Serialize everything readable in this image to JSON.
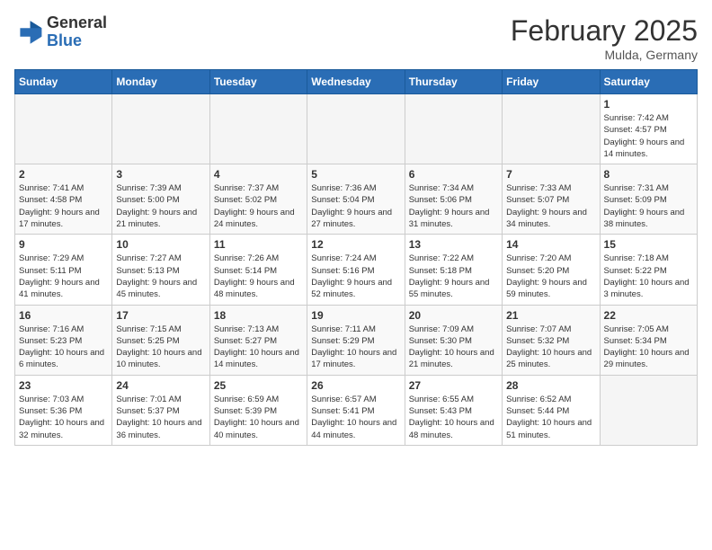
{
  "header": {
    "logo_general": "General",
    "logo_blue": "Blue",
    "month_year": "February 2025",
    "location": "Mulda, Germany"
  },
  "weekdays": [
    "Sunday",
    "Monday",
    "Tuesday",
    "Wednesday",
    "Thursday",
    "Friday",
    "Saturday"
  ],
  "weeks": [
    [
      {
        "day": "",
        "info": ""
      },
      {
        "day": "",
        "info": ""
      },
      {
        "day": "",
        "info": ""
      },
      {
        "day": "",
        "info": ""
      },
      {
        "day": "",
        "info": ""
      },
      {
        "day": "",
        "info": ""
      },
      {
        "day": "1",
        "info": "Sunrise: 7:42 AM\nSunset: 4:57 PM\nDaylight: 9 hours and 14 minutes."
      }
    ],
    [
      {
        "day": "2",
        "info": "Sunrise: 7:41 AM\nSunset: 4:58 PM\nDaylight: 9 hours and 17 minutes."
      },
      {
        "day": "3",
        "info": "Sunrise: 7:39 AM\nSunset: 5:00 PM\nDaylight: 9 hours and 21 minutes."
      },
      {
        "day": "4",
        "info": "Sunrise: 7:37 AM\nSunset: 5:02 PM\nDaylight: 9 hours and 24 minutes."
      },
      {
        "day": "5",
        "info": "Sunrise: 7:36 AM\nSunset: 5:04 PM\nDaylight: 9 hours and 27 minutes."
      },
      {
        "day": "6",
        "info": "Sunrise: 7:34 AM\nSunset: 5:06 PM\nDaylight: 9 hours and 31 minutes."
      },
      {
        "day": "7",
        "info": "Sunrise: 7:33 AM\nSunset: 5:07 PM\nDaylight: 9 hours and 34 minutes."
      },
      {
        "day": "8",
        "info": "Sunrise: 7:31 AM\nSunset: 5:09 PM\nDaylight: 9 hours and 38 minutes."
      }
    ],
    [
      {
        "day": "9",
        "info": "Sunrise: 7:29 AM\nSunset: 5:11 PM\nDaylight: 9 hours and 41 minutes."
      },
      {
        "day": "10",
        "info": "Sunrise: 7:27 AM\nSunset: 5:13 PM\nDaylight: 9 hours and 45 minutes."
      },
      {
        "day": "11",
        "info": "Sunrise: 7:26 AM\nSunset: 5:14 PM\nDaylight: 9 hours and 48 minutes."
      },
      {
        "day": "12",
        "info": "Sunrise: 7:24 AM\nSunset: 5:16 PM\nDaylight: 9 hours and 52 minutes."
      },
      {
        "day": "13",
        "info": "Sunrise: 7:22 AM\nSunset: 5:18 PM\nDaylight: 9 hours and 55 minutes."
      },
      {
        "day": "14",
        "info": "Sunrise: 7:20 AM\nSunset: 5:20 PM\nDaylight: 9 hours and 59 minutes."
      },
      {
        "day": "15",
        "info": "Sunrise: 7:18 AM\nSunset: 5:22 PM\nDaylight: 10 hours and 3 minutes."
      }
    ],
    [
      {
        "day": "16",
        "info": "Sunrise: 7:16 AM\nSunset: 5:23 PM\nDaylight: 10 hours and 6 minutes."
      },
      {
        "day": "17",
        "info": "Sunrise: 7:15 AM\nSunset: 5:25 PM\nDaylight: 10 hours and 10 minutes."
      },
      {
        "day": "18",
        "info": "Sunrise: 7:13 AM\nSunset: 5:27 PM\nDaylight: 10 hours and 14 minutes."
      },
      {
        "day": "19",
        "info": "Sunrise: 7:11 AM\nSunset: 5:29 PM\nDaylight: 10 hours and 17 minutes."
      },
      {
        "day": "20",
        "info": "Sunrise: 7:09 AM\nSunset: 5:30 PM\nDaylight: 10 hours and 21 minutes."
      },
      {
        "day": "21",
        "info": "Sunrise: 7:07 AM\nSunset: 5:32 PM\nDaylight: 10 hours and 25 minutes."
      },
      {
        "day": "22",
        "info": "Sunrise: 7:05 AM\nSunset: 5:34 PM\nDaylight: 10 hours and 29 minutes."
      }
    ],
    [
      {
        "day": "23",
        "info": "Sunrise: 7:03 AM\nSunset: 5:36 PM\nDaylight: 10 hours and 32 minutes."
      },
      {
        "day": "24",
        "info": "Sunrise: 7:01 AM\nSunset: 5:37 PM\nDaylight: 10 hours and 36 minutes."
      },
      {
        "day": "25",
        "info": "Sunrise: 6:59 AM\nSunset: 5:39 PM\nDaylight: 10 hours and 40 minutes."
      },
      {
        "day": "26",
        "info": "Sunrise: 6:57 AM\nSunset: 5:41 PM\nDaylight: 10 hours and 44 minutes."
      },
      {
        "day": "27",
        "info": "Sunrise: 6:55 AM\nSunset: 5:43 PM\nDaylight: 10 hours and 48 minutes."
      },
      {
        "day": "28",
        "info": "Sunrise: 6:52 AM\nSunset: 5:44 PM\nDaylight: 10 hours and 51 minutes."
      },
      {
        "day": "",
        "info": ""
      }
    ]
  ]
}
